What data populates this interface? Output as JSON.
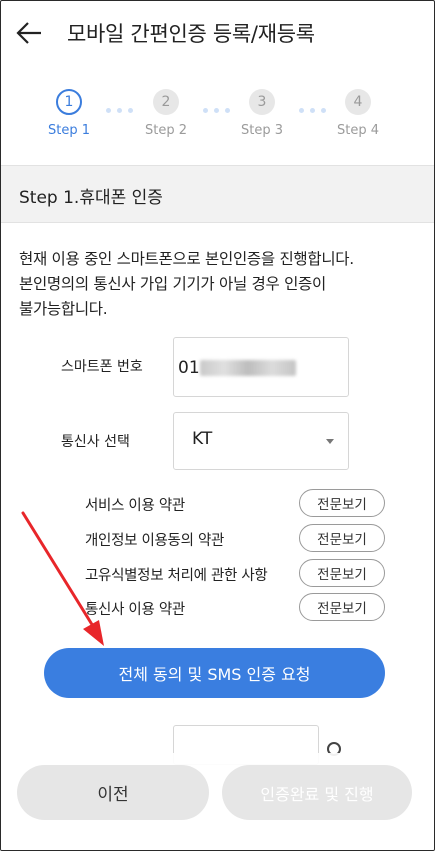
{
  "header": {
    "title": "모바일 간편인증 등록/재등록",
    "back_icon": "arrow-left-icon"
  },
  "stepper": {
    "steps": [
      {
        "number": "1",
        "label": "Step 1",
        "state": "active"
      },
      {
        "number": "2",
        "label": "Step 2",
        "state": "inactive"
      },
      {
        "number": "3",
        "label": "Step 3",
        "state": "inactive"
      },
      {
        "number": "4",
        "label": "Step 4",
        "state": "inactive"
      }
    ]
  },
  "section": {
    "title": "Step 1.휴대폰 인증"
  },
  "description": {
    "line1": "현재 이용 중인 스마트폰으로 본인인증을 진행합니다.",
    "line2": "본인명의의 통신사 가입 기기가 아닐 경우 인증이",
    "line3": "불가능합니다."
  },
  "form": {
    "phone_label": "스마트폰 번호",
    "phone_value": "01",
    "carrier_label": "통신사 선택",
    "carrier_value": "KT"
  },
  "terms": [
    {
      "label": "서비스 이용 약관",
      "button": "전문보기"
    },
    {
      "label": "개인정보 이용동의 약관",
      "button": "전문보기"
    },
    {
      "label": "고유식별정보 처리에 관한 사항",
      "button": "전문보기"
    },
    {
      "label": "통신사 이용 약관",
      "button": "전문보기"
    }
  ],
  "actions": {
    "agree_sms": "전체 동의 및 SMS 인증 요청",
    "prev": "이전",
    "complete": "인증완료 및 진행"
  },
  "colors": {
    "accent": "#3a7ee0",
    "annotation_arrow": "#e8262a"
  }
}
